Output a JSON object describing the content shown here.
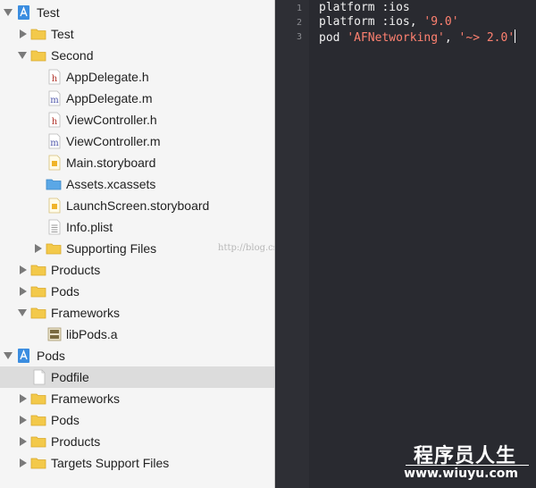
{
  "navigator": {
    "items": [
      {
        "label": "Test",
        "icon": "xcodeproj-icon",
        "expand": "open"
      },
      {
        "label": "Test",
        "icon": "folder-icon",
        "expand": "closed"
      },
      {
        "label": "Second",
        "icon": "folder-icon",
        "expand": "open"
      },
      {
        "label": "AppDelegate.h",
        "icon": "header-file-icon",
        "expand": ""
      },
      {
        "label": "AppDelegate.m",
        "icon": "objc-file-icon",
        "expand": ""
      },
      {
        "label": "ViewController.h",
        "icon": "header-file-icon",
        "expand": ""
      },
      {
        "label": "ViewController.m",
        "icon": "objc-file-icon",
        "expand": ""
      },
      {
        "label": "Main.storyboard",
        "icon": "storyboard-icon",
        "expand": ""
      },
      {
        "label": "Assets.xcassets",
        "icon": "xcassets-folder-icon",
        "expand": ""
      },
      {
        "label": "LaunchScreen.storyboard",
        "icon": "storyboard-icon",
        "expand": ""
      },
      {
        "label": "Info.plist",
        "icon": "plist-icon",
        "expand": ""
      },
      {
        "label": "Supporting Files",
        "icon": "folder-icon",
        "expand": "closed"
      },
      {
        "label": "Products",
        "icon": "folder-icon",
        "expand": "closed"
      },
      {
        "label": "Pods",
        "icon": "folder-icon",
        "expand": "closed"
      },
      {
        "label": "Frameworks",
        "icon": "folder-icon",
        "expand": "open"
      },
      {
        "label": "libPods.a",
        "icon": "library-icon",
        "expand": ""
      },
      {
        "label": "Pods",
        "icon": "xcodeproj-icon",
        "expand": "open"
      },
      {
        "label": "Podfile",
        "icon": "text-file-icon",
        "expand": "",
        "selected": true
      },
      {
        "label": "Frameworks",
        "icon": "folder-icon",
        "expand": "closed"
      },
      {
        "label": "Pods",
        "icon": "folder-icon",
        "expand": "closed"
      },
      {
        "label": "Products",
        "icon": "folder-icon",
        "expand": "closed"
      },
      {
        "label": "Targets Support Files",
        "icon": "folder-icon",
        "expand": "closed"
      }
    ]
  },
  "editor": {
    "line_numbers": [
      "1",
      "2",
      "3"
    ],
    "lines": [
      {
        "plain": "platform :ios",
        "s1": "",
        "mid": "",
        "s2": ""
      },
      {
        "plain": "platform :ios, ",
        "s1": "'9.0'",
        "mid": "",
        "s2": ""
      },
      {
        "plain": "pod ",
        "s1": "'AFNetworking'",
        "mid": ", ",
        "s2": "'~> 2.0'"
      }
    ]
  },
  "watermark": {
    "text": "http://blog.csdn.net/"
  },
  "brand": {
    "name": "程序员人生",
    "url": "www.wiuyu.com"
  },
  "colors": {
    "string": "#ff8170",
    "editor_bg": "#292a30",
    "selection": "#dcdcdc",
    "folder": "#f3c94a"
  }
}
